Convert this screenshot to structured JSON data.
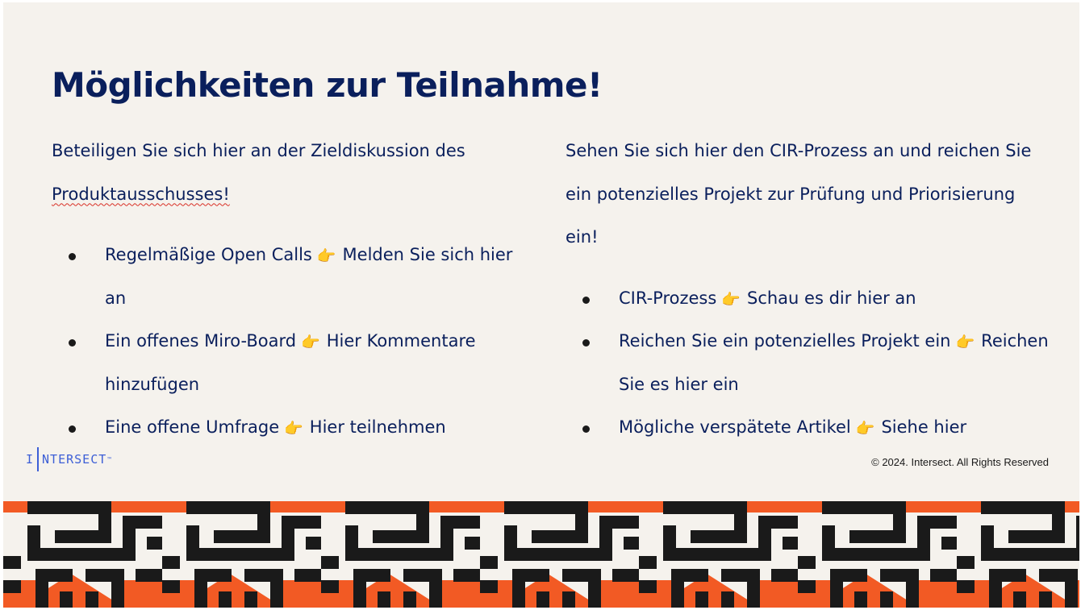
{
  "title": "Möglichkeiten zur Teilnahme!",
  "left": {
    "intro_line1": "Beteiligen Sie sich hier an der Zieldiskussion des",
    "intro_line2": "Produktausschusses!",
    "bullets": [
      {
        "text": "Regelmäßige Open Calls",
        "link": "Melden Sie sich hier an"
      },
      {
        "text": "Ein offenes Miro-Board",
        "link": "Hier Kommentare hinzufügen"
      },
      {
        "text": "Eine offene Umfrage",
        "link": "Hier teilnehmen"
      }
    ]
  },
  "right": {
    "intro": "Sehen Sie sich hier den CIR-Prozess an und reichen Sie ein potenzielles Projekt zur Prüfung und Priorisierung ein!",
    "bullets": [
      {
        "text": "CIR-Prozess",
        "link": "Schau es dir hier an"
      },
      {
        "text": "Reichen Sie ein potenzielles Projekt ein",
        "link": "Reichen Sie es hier ein"
      },
      {
        "text": "Mögliche verspätete Artikel",
        "link": "Siehe hier"
      }
    ]
  },
  "logo": {
    "prefix": "I",
    "rest": "NTERSECT",
    "tm": "™"
  },
  "copyright": "© 2024. Intersect. All Rights Reserved",
  "pointer_glyph": "👉",
  "colors": {
    "background": "#f5f2ed",
    "title": "#0a1f5c",
    "logo": "#3d5fd6",
    "pattern_orange": "#f25a24",
    "pattern_black": "#1a1a1a",
    "pattern_cream": "#f5f2ed"
  },
  "icons": {
    "pointer": "backhand-index-pointing-right-icon",
    "bullet": "bullet-dot-icon"
  }
}
